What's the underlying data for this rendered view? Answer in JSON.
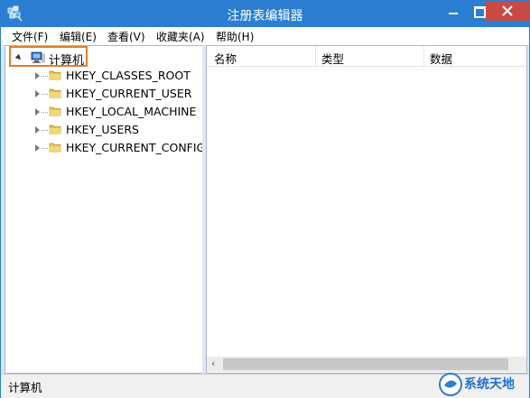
{
  "window": {
    "title": "注册表编辑器"
  },
  "menu": [
    {
      "label": "文件(F)"
    },
    {
      "label": "编辑(E)"
    },
    {
      "label": "查看(V)"
    },
    {
      "label": "收藏夹(A)"
    },
    {
      "label": "帮助(H)"
    }
  ],
  "tree": {
    "root": {
      "label": "计算机",
      "expanded": true
    },
    "children": [
      {
        "label": "HKEY_CLASSES_ROOT"
      },
      {
        "label": "HKEY_CURRENT_USER"
      },
      {
        "label": "HKEY_LOCAL_MACHINE"
      },
      {
        "label": "HKEY_USERS"
      },
      {
        "label": "HKEY_CURRENT_CONFIG"
      }
    ]
  },
  "list": {
    "columns": [
      {
        "label": "名称"
      },
      {
        "label": "类型"
      },
      {
        "label": "数据"
      }
    ]
  },
  "status": {
    "path": "计算机"
  },
  "watermark": {
    "text": "系统天地"
  },
  "colors": {
    "titlebar": "#2b7ed1",
    "close": "#c74a44",
    "highlight": "#e07d2b"
  }
}
